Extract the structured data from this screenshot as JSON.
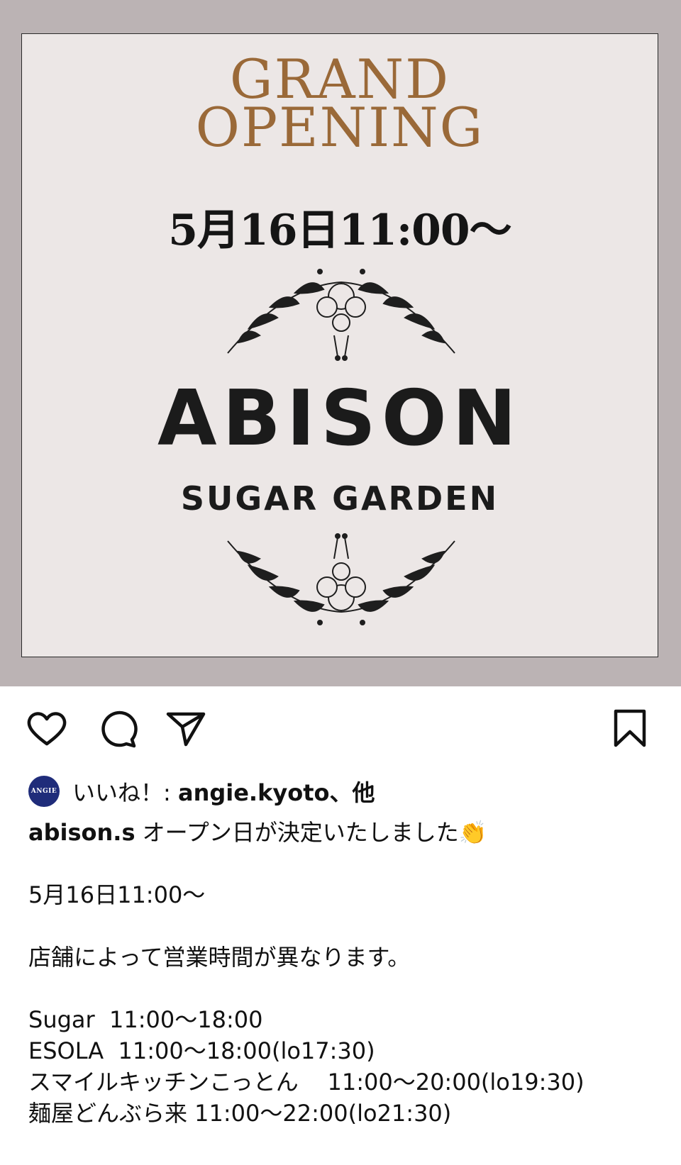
{
  "post": {
    "image": {
      "grand_line1": "GRAND",
      "grand_line2": "OPENING",
      "date": "5月16日11:00〜",
      "brand": "ABISON",
      "brand_sub": "SUGAR GARDEN"
    },
    "likes": {
      "avatar_text": "ANGIE",
      "prefix": "いいね！: ",
      "user": "angie.kyoto",
      "suffix": "、他"
    },
    "caption": {
      "username": "abison.s",
      "text": " オープン日が決定いたしました👏",
      "date_line": "5月16日11:00〜",
      "note": "店舗によって営業時間が異なります。",
      "hours": [
        "Sugar  11:00〜18:00",
        "ESOLA  11:00〜18:00(lo17:30)",
        "スマイルキッチンこっとん    11:00〜20:00(lo19:30)",
        "麺屋どんぶら来 11:00〜22:00(lo21:30)"
      ]
    }
  },
  "icons": {
    "like": "heart-icon",
    "comment": "comment-icon",
    "share": "send-icon",
    "save": "bookmark-icon"
  },
  "colors": {
    "frame": "#bbb3b4",
    "poster_bg": "#ece7e6",
    "gold": "#9a6938",
    "avatar": "#1f2c7a"
  }
}
